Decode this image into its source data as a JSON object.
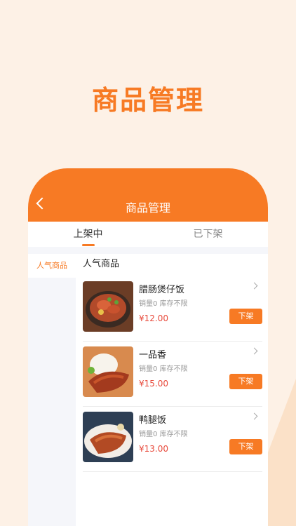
{
  "hero": {
    "title": "商品管理"
  },
  "nav": {
    "title": "商品管理"
  },
  "tabs": [
    {
      "label": "上架中",
      "active": true
    },
    {
      "label": "已下架",
      "active": false
    }
  ],
  "sidebar": {
    "items": [
      {
        "label": "人气商品"
      }
    ]
  },
  "section": {
    "title": "人气商品"
  },
  "products": [
    {
      "name": "腊肠煲仔饭",
      "meta": "销量0 库存不限",
      "price": "¥12.00",
      "button": "下架"
    },
    {
      "name": "一品香",
      "meta": "销量0 库存不限",
      "price": "¥15.00",
      "button": "下架"
    },
    {
      "name": "鸭腿饭",
      "meta": "销量0 库存不限",
      "price": "¥13.00",
      "button": "下架"
    }
  ],
  "colors": {
    "accent": "#f77a24",
    "price": "#e84a3c",
    "background": "#fdf1e6"
  }
}
